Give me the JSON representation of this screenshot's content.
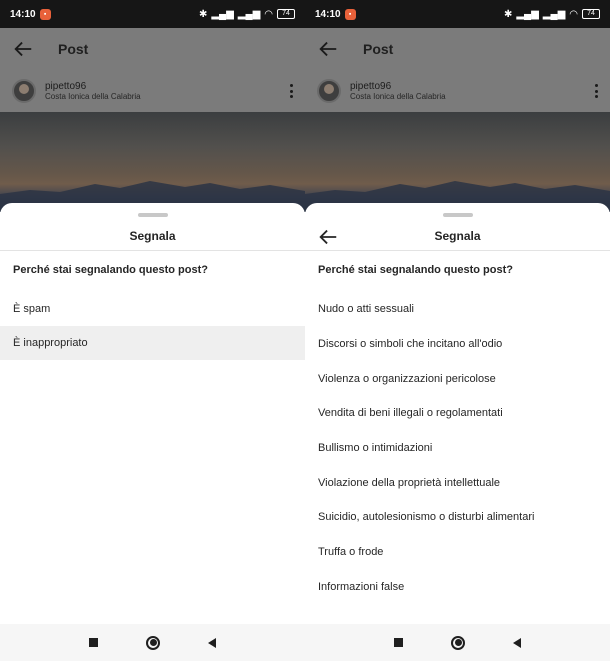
{
  "status_bar": {
    "time": "14:10",
    "battery": "74"
  },
  "appbar": {
    "title": "Post"
  },
  "post": {
    "username": "pipetto96",
    "location": "Costa Ionica della Calabria"
  },
  "colors": {
    "sheet_bg": "#ffffff",
    "dim_overlay": "#7b7b7b",
    "selected_row": "#efefef",
    "text": "#262626"
  },
  "icons": {
    "back": "arrow-left-icon",
    "more": "more-vertical-icon",
    "nav_recents": "square-icon",
    "nav_home": "circle-icon",
    "nav_back": "triangle-back-icon"
  },
  "left_sheet": {
    "title": "Segnala",
    "question": "Perché stai segnalando questo post?",
    "options": [
      {
        "label": "È spam",
        "selected": false
      },
      {
        "label": "È inappropriato",
        "selected": true
      }
    ]
  },
  "right_sheet": {
    "title": "Segnala",
    "question": "Perché stai segnalando questo post?",
    "options": [
      {
        "label": "Nudo o atti sessuali"
      },
      {
        "label": "Discorsi o simboli che incitano all'odio"
      },
      {
        "label": "Violenza o organizzazioni pericolose"
      },
      {
        "label": "Vendita di beni illegali o regolamentati"
      },
      {
        "label": "Bullismo o intimidazioni"
      },
      {
        "label": "Violazione della proprietà intellettuale"
      },
      {
        "label": "Suicidio, autolesionismo o disturbi alimentari"
      },
      {
        "label": "Truffa o frode"
      },
      {
        "label": "Informazioni false"
      }
    ]
  }
}
